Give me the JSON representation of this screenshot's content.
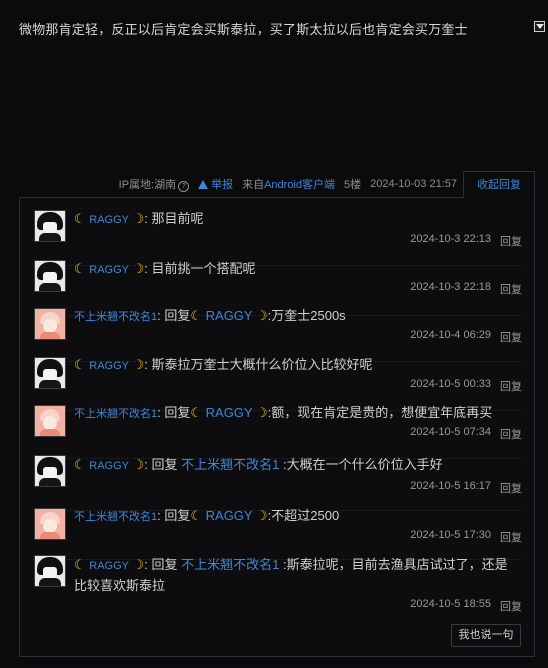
{
  "post": {
    "text": "微物那肯定轻，反正以后肯定会买斯泰拉，买了斯太拉以后也肯定会买万奎士"
  },
  "meta": {
    "ip_label": "IP属地:湖南",
    "report_label": "举报",
    "client_prefix": "来自",
    "client_name": "Android客户端",
    "floor": "5楼",
    "datetime": "2024-10-03 21:57",
    "collapse_label": "收起回复"
  },
  "replies": [
    {
      "user": "RAGGY",
      "pre": "",
      "target": "",
      "mid": ": 那目前呢",
      "time": "2024-10-3 22:13",
      "reply_label": "回复"
    },
    {
      "user": "RAGGY",
      "pre": "",
      "target": "",
      "mid": ": 目前挑一个搭配呢",
      "time": "2024-10-3 22:18",
      "reply_label": "回复"
    },
    {
      "user": "不上米翘不改名1",
      "pre": ": 回复",
      "target": "RAGGY",
      "mid": ":万奎士2500s",
      "time": "2024-10-4 06:29",
      "reply_label": "回复"
    },
    {
      "user": "RAGGY",
      "pre": "",
      "target": "",
      "mid": ": 斯泰拉万奎士大概什么价位入比较好呢",
      "time": "2024-10-5 00:33",
      "reply_label": "回复"
    },
    {
      "user": "不上米翘不改名1",
      "pre": ": 回复",
      "target": "RAGGY",
      "mid": ":额，现在肯定是贵的，想便宜年底再买",
      "time": "2024-10-5 07:34",
      "reply_label": "回复"
    },
    {
      "user": "RAGGY",
      "pre": ": 回复 ",
      "target": "不上米翘不改名1",
      "mid": " :大概在一个什么价位入手好",
      "time": "2024-10-5 16:17",
      "reply_label": "回复"
    },
    {
      "user": "不上米翘不改名1",
      "pre": ": 回复",
      "target": "RAGGY",
      "mid": ":不超过2500",
      "time": "2024-10-5 17:30",
      "reply_label": "回复"
    },
    {
      "user": "RAGGY",
      "pre": ": 回复 ",
      "target": "不上米翘不改名1",
      "mid": " :斯泰拉呢，目前去渔具店试过了，还是比较喜欢斯泰拉",
      "time": "2024-10-5 18:55",
      "reply_label": "回复"
    }
  ],
  "say_button": "我也说一句",
  "colors": {
    "link": "#3f86d6",
    "moon": "#f1c40f",
    "background": "#0b0b0e"
  }
}
